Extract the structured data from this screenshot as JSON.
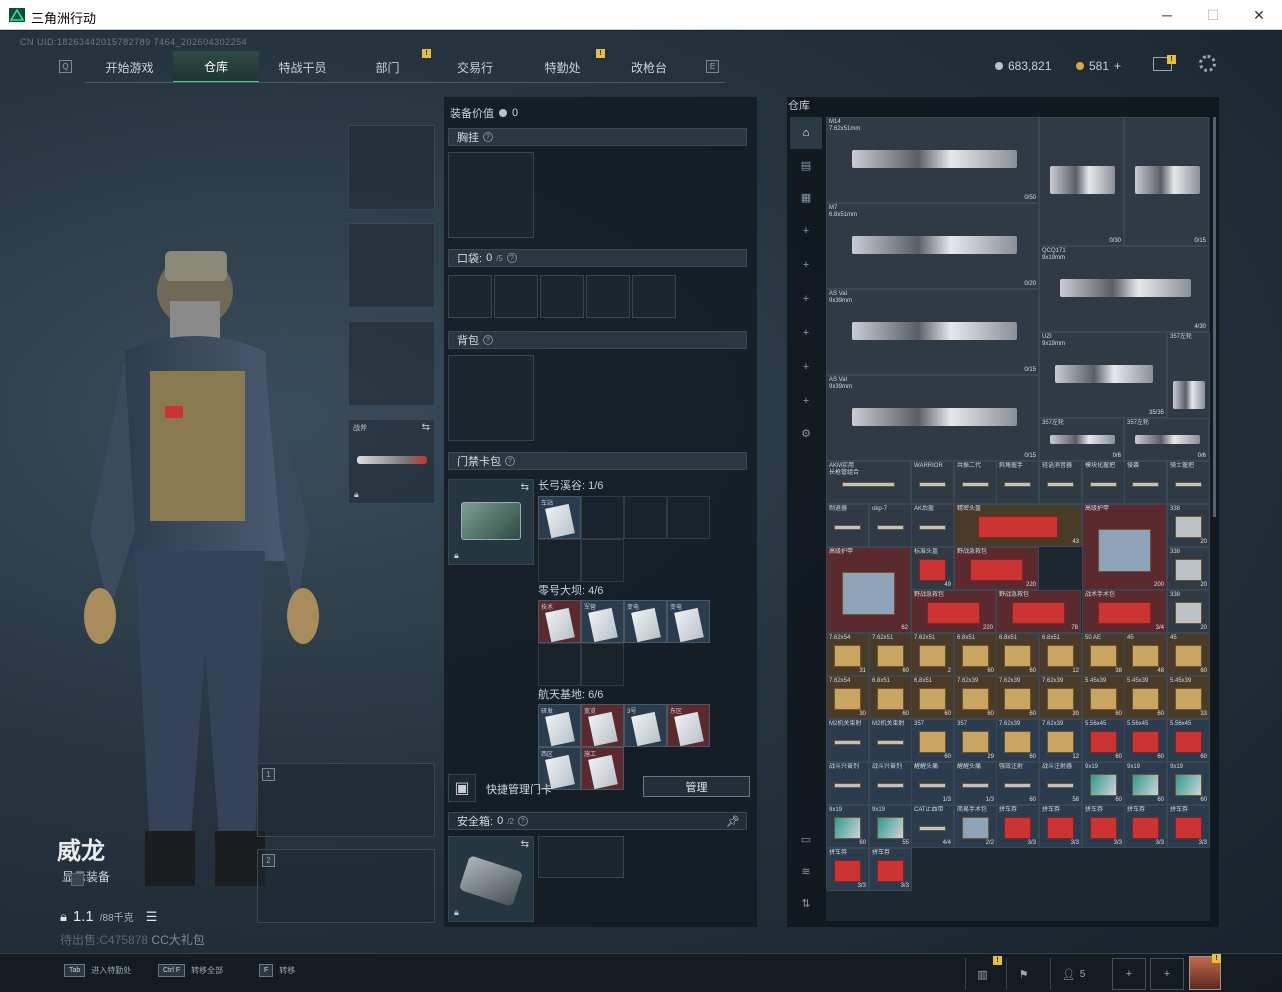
{
  "window": {
    "title": "三角洲行动"
  },
  "uid": "CN UID:18263442015782789 7464_202604302254",
  "nav": {
    "tabs": [
      "开始游戏",
      "仓库",
      "特战干员",
      "部门",
      "交易行",
      "特勤处",
      "改枪台"
    ],
    "active": "仓库"
  },
  "currency": {
    "hafbi": "683,821",
    "coin": "581",
    "plus": "+"
  },
  "operator": {
    "name": "威龙",
    "show_gear": "显示装备",
    "weight": "1.1",
    "weight_unit": "/88千克",
    "pending_label": "待出售:",
    "pending_value": "C475878",
    "gift_label": "CC大礼包"
  },
  "weapon_slots": [
    {
      "idx": "1"
    },
    {
      "idx": "2"
    }
  ],
  "melee_label": "战斧",
  "equipment": {
    "value_label": "装备价值",
    "value": "0",
    "chest_rig": "胸挂",
    "pockets": "口袋:",
    "pockets_count": "0",
    "pockets_cap": "/5",
    "backpack": "背包",
    "keycard_bag": "门禁卡包",
    "quick_manage": "快捷管理门卡",
    "manage_btn": "管理",
    "safe_box": "安全箱:",
    "safe_count": "0",
    "safe_cap": "/2"
  },
  "keycard_groups": [
    {
      "name": "长弓溪谷: 1/6",
      "cards": [
        "车站"
      ]
    },
    {
      "name": "零号大坝: 4/6",
      "cards": [
        "技术",
        "军营",
        "变电",
        "变电"
      ]
    },
    {
      "name": "航天基地: 6/6",
      "cards": [
        "研发",
        "宽览",
        "3号",
        "东区",
        "西区",
        "施工"
      ]
    }
  ],
  "stash": {
    "title": "仓库",
    "items": [
      {
        "n": "M14\n7.62x51mm",
        "s": "0/50",
        "c": "c-gray",
        "t": "gun"
      },
      {
        "n": "",
        "s": "0/30",
        "c": "c-gray",
        "t": "gun"
      },
      {
        "n": "",
        "s": "0/15",
        "c": "c-gray",
        "t": "gun"
      },
      {
        "n": "M7\n6.8x51mm",
        "s": "0/20",
        "c": "c-gray",
        "t": "gun"
      },
      {
        "n": "QCQ171\n9x19mm",
        "s": "4/30",
        "c": "c-gray",
        "t": "gun"
      },
      {
        "n": "AS Val\n9x39mm",
        "s": "0/15",
        "c": "c-gray",
        "t": "gun"
      },
      {
        "n": "UZI\n9x19mm",
        "s": "35/35",
        "c": "c-gray",
        "t": "gun"
      },
      {
        "n": "357左轮",
        "s": "0/6",
        "c": "c-gray",
        "t": "gun"
      },
      {
        "n": "AS Val\n9x39mm",
        "s": "0/15",
        "c": "c-gray",
        "t": "gun"
      },
      {
        "n": "357左轮",
        "s": "0/6",
        "c": "c-gray",
        "t": "gun"
      },
      {
        "n": "357左轮",
        "s": "0/6",
        "c": "c-gray",
        "t": "gun"
      },
      {
        "n": "AKM实用\n长枪管组合",
        "s": "",
        "c": "c-gray",
        "t": "part"
      },
      {
        "n": "WARRIOR",
        "s": "",
        "c": "c-gray",
        "t": "part"
      },
      {
        "n": "共振二代",
        "s": "",
        "c": "c-gray",
        "t": "part"
      },
      {
        "n": "斜角握手",
        "s": "",
        "c": "c-gray",
        "t": "part"
      },
      {
        "n": "轻语消音器",
        "s": "",
        "c": "c-gray",
        "t": "part"
      },
      {
        "n": "模块化握把",
        "s": "",
        "c": "c-gray",
        "t": "part"
      },
      {
        "n": "侵袭",
        "s": "",
        "c": "c-gray",
        "t": "part"
      },
      {
        "n": "骑士握把",
        "s": "",
        "c": "c-gray",
        "t": "part"
      },
      {
        "n": "制退器",
        "s": "",
        "c": "c-gray",
        "t": "part"
      },
      {
        "n": "okp-7",
        "s": "",
        "c": "c-gray",
        "t": "part"
      },
      {
        "n": "AK后握",
        "s": "",
        "c": "c-gray",
        "t": "part"
      },
      {
        "n": "精密头盔",
        "s": "43",
        "c": "c-brown",
        "t": "med"
      },
      {
        "n": "高级护甲",
        "s": "200",
        "c": "c-red",
        "t": "bag"
      },
      {
        "n": "338",
        "s": "20",
        "c": "c-gray",
        "t": "box"
      },
      {
        "n": "高级护甲",
        "s": "62",
        "c": "c-red",
        "t": "bag"
      },
      {
        "n": "标准头盔",
        "s": "49",
        "c": "c-gray",
        "t": "med"
      },
      {
        "n": "野战急救包",
        "s": "220",
        "c": "c-red",
        "t": "med"
      },
      {
        "n": "338",
        "s": "20",
        "c": "c-gray",
        "t": "box"
      },
      {
        "n": "野战急救包",
        "s": "220",
        "c": "c-red",
        "t": "med"
      },
      {
        "n": "野战急救包",
        "s": "78",
        "c": "c-red",
        "t": "med"
      },
      {
        "n": "战术手术包",
        "s": "3/4",
        "c": "c-red",
        "t": "med"
      },
      {
        "n": "338",
        "s": "20",
        "c": "c-gray",
        "t": "box"
      },
      {
        "n": "7.62x54",
        "s": "31",
        "c": "c-brown",
        "t": "ammo"
      },
      {
        "n": "7.62x51",
        "s": "60",
        "c": "c-brown",
        "t": "ammo"
      },
      {
        "n": "7.62x51",
        "s": "2",
        "c": "c-brown",
        "t": "ammo"
      },
      {
        "n": "6.8x51",
        "s": "60",
        "c": "c-brown",
        "t": "ammo"
      },
      {
        "n": "6.8x51",
        "s": "60",
        "c": "c-brown",
        "t": "ammo"
      },
      {
        "n": "6.8x51",
        "s": "12",
        "c": "c-brown",
        "t": "ammo"
      },
      {
        "n": "50 AE",
        "s": "38",
        "c": "c-brown",
        "t": "ammo"
      },
      {
        "n": "45",
        "s": "48",
        "c": "c-brown",
        "t": "ammo"
      },
      {
        "n": "45",
        "s": "60",
        "c": "c-brown",
        "t": "ammo"
      },
      {
        "n": "7.62x54",
        "s": "30",
        "c": "c-brown",
        "t": "ammo"
      },
      {
        "n": "6.8x51",
        "s": "60",
        "c": "c-brown",
        "t": "ammo"
      },
      {
        "n": "6.8x51",
        "s": "60",
        "c": "c-brown",
        "t": "ammo"
      },
      {
        "n": "7.62x39",
        "s": "60",
        "c": "c-brown",
        "t": "ammo"
      },
      {
        "n": "7.62x39",
        "s": "60",
        "c": "c-brown",
        "t": "ammo"
      },
      {
        "n": "7.62x39",
        "s": "30",
        "c": "c-brown",
        "t": "ammo"
      },
      {
        "n": "5.45x39",
        "s": "60",
        "c": "c-brown",
        "t": "ammo"
      },
      {
        "n": "5.45x39",
        "s": "60",
        "c": "c-brown",
        "t": "ammo"
      },
      {
        "n": "5.45x39",
        "s": "33",
        "c": "c-brown",
        "t": "ammo"
      },
      {
        "n": "M2机关束射",
        "s": "",
        "c": "c-blue",
        "t": "inj"
      },
      {
        "n": "M2机关束射",
        "s": "",
        "c": "c-blue",
        "t": "inj"
      },
      {
        "n": "357",
        "s": "60",
        "c": "c-blue",
        "t": "ammo"
      },
      {
        "n": "357",
        "s": "29",
        "c": "c-blue",
        "t": "ammo"
      },
      {
        "n": "7.62x39",
        "s": "60",
        "c": "c-blue",
        "t": "ammo"
      },
      {
        "n": "7.62x39",
        "s": "12",
        "c": "c-blue",
        "t": "ammo"
      },
      {
        "n": "5.56x45",
        "s": "60",
        "c": "c-blue",
        "t": "rammo"
      },
      {
        "n": "5.56x45",
        "s": "60",
        "c": "c-blue",
        "t": "rammo"
      },
      {
        "n": "5.56x45",
        "s": "60",
        "c": "c-blue",
        "t": "rammo"
      },
      {
        "n": "战斗兴奋剂",
        "s": "",
        "c": "c-blue",
        "t": "inj"
      },
      {
        "n": "战斗兴奋剂",
        "s": "",
        "c": "c-blue",
        "t": "inj"
      },
      {
        "n": "醒醒头痛",
        "s": "1/3",
        "c": "c-blue",
        "t": "inj"
      },
      {
        "n": "醒醒头痛",
        "s": "1/3",
        "c": "c-blue",
        "t": "inj"
      },
      {
        "n": "强效注射",
        "s": "60",
        "c": "c-blue",
        "t": "inj"
      },
      {
        "n": "战斗注射器",
        "s": "58",
        "c": "c-blue",
        "t": "inj"
      },
      {
        "n": "9x19",
        "s": "60",
        "c": "c-blue",
        "t": "gammo"
      },
      {
        "n": "9x19",
        "s": "60",
        "c": "c-blue",
        "t": "gammo"
      },
      {
        "n": "9x19",
        "s": "60",
        "c": "c-blue",
        "t": "gammo"
      },
      {
        "n": "9x19",
        "s": "60",
        "c": "c-blue",
        "t": "gammo"
      },
      {
        "n": "9x19",
        "s": "55",
        "c": "c-blue",
        "t": "gammo"
      },
      {
        "n": "CAT止血带",
        "s": "4/4",
        "c": "c-blue",
        "t": "part"
      },
      {
        "n": "简易手术包",
        "s": "2/2",
        "c": "c-blue",
        "t": "bag"
      },
      {
        "n": "拼车券",
        "s": "3/3",
        "c": "c-blue",
        "t": "red"
      },
      {
        "n": "拼车券",
        "s": "3/3",
        "c": "c-blue",
        "t": "red"
      },
      {
        "n": "拼车券",
        "s": "3/3",
        "c": "c-blue",
        "t": "red"
      },
      {
        "n": "拼车券",
        "s": "3/3",
        "c": "c-blue",
        "t": "red"
      },
      {
        "n": "拼车券",
        "s": "3/3",
        "c": "c-blue",
        "t": "red"
      },
      {
        "n": "拼车券",
        "s": "3/3",
        "c": "c-blue",
        "t": "red"
      },
      {
        "n": "拼车券",
        "s": "3/3",
        "c": "c-blue",
        "t": "red"
      }
    ]
  },
  "bottom": {
    "hint1_key": "Tab",
    "hint1": "进入特勤处",
    "hint2_key": "Ctrl F",
    "hint2": "转移全部",
    "hint3_key": "F",
    "hint3": "转移",
    "friends": "5"
  }
}
